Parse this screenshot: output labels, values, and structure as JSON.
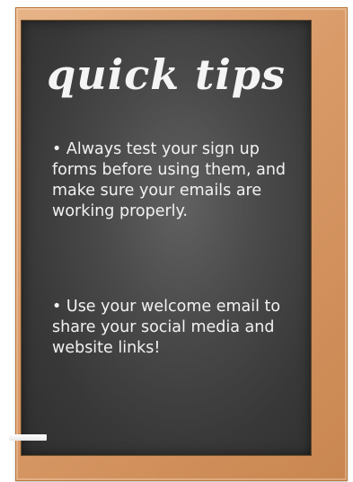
{
  "board": {
    "title": "quick tips",
    "tips": [
      "• Always test your sign up forms before using them, and make sure your emails are working properly.",
      "• Use your welcome email to share your social media and website links!"
    ]
  },
  "colors": {
    "frame_wood": "#d99a68",
    "chalkboard": "#3f3f3f",
    "chalk_text": "#f2f2f2"
  }
}
